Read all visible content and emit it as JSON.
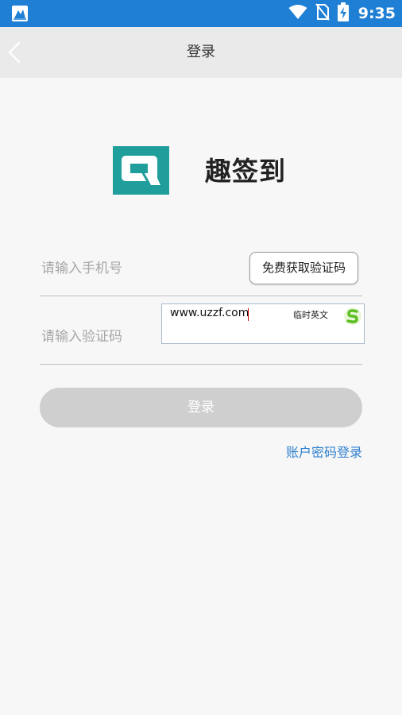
{
  "status_bar": {
    "time": "9:35",
    "icons": [
      "app-notification-icon",
      "wifi-icon",
      "no-sim-icon",
      "battery-charging-icon"
    ]
  },
  "header": {
    "title": "登录",
    "back_icon": "chevron-left-icon"
  },
  "brand": {
    "app_name": "趣签到",
    "logo_letter": "Q",
    "logo_color": "#1f9e9b"
  },
  "form": {
    "phone_placeholder": "请输入手机号",
    "phone_value": "",
    "get_code_label": "免费获取验证码",
    "code_placeholder": "请输入验证码",
    "code_value": ""
  },
  "ime": {
    "text": "www.uzzf.com",
    "mode_label": "临时英文"
  },
  "actions": {
    "login_label": "登录",
    "password_login_label": "账户密码登录"
  },
  "colors": {
    "status_bar": "#1e7fd4",
    "link": "#2f7fd0",
    "login_button_disabled": "#cfcfcf"
  }
}
